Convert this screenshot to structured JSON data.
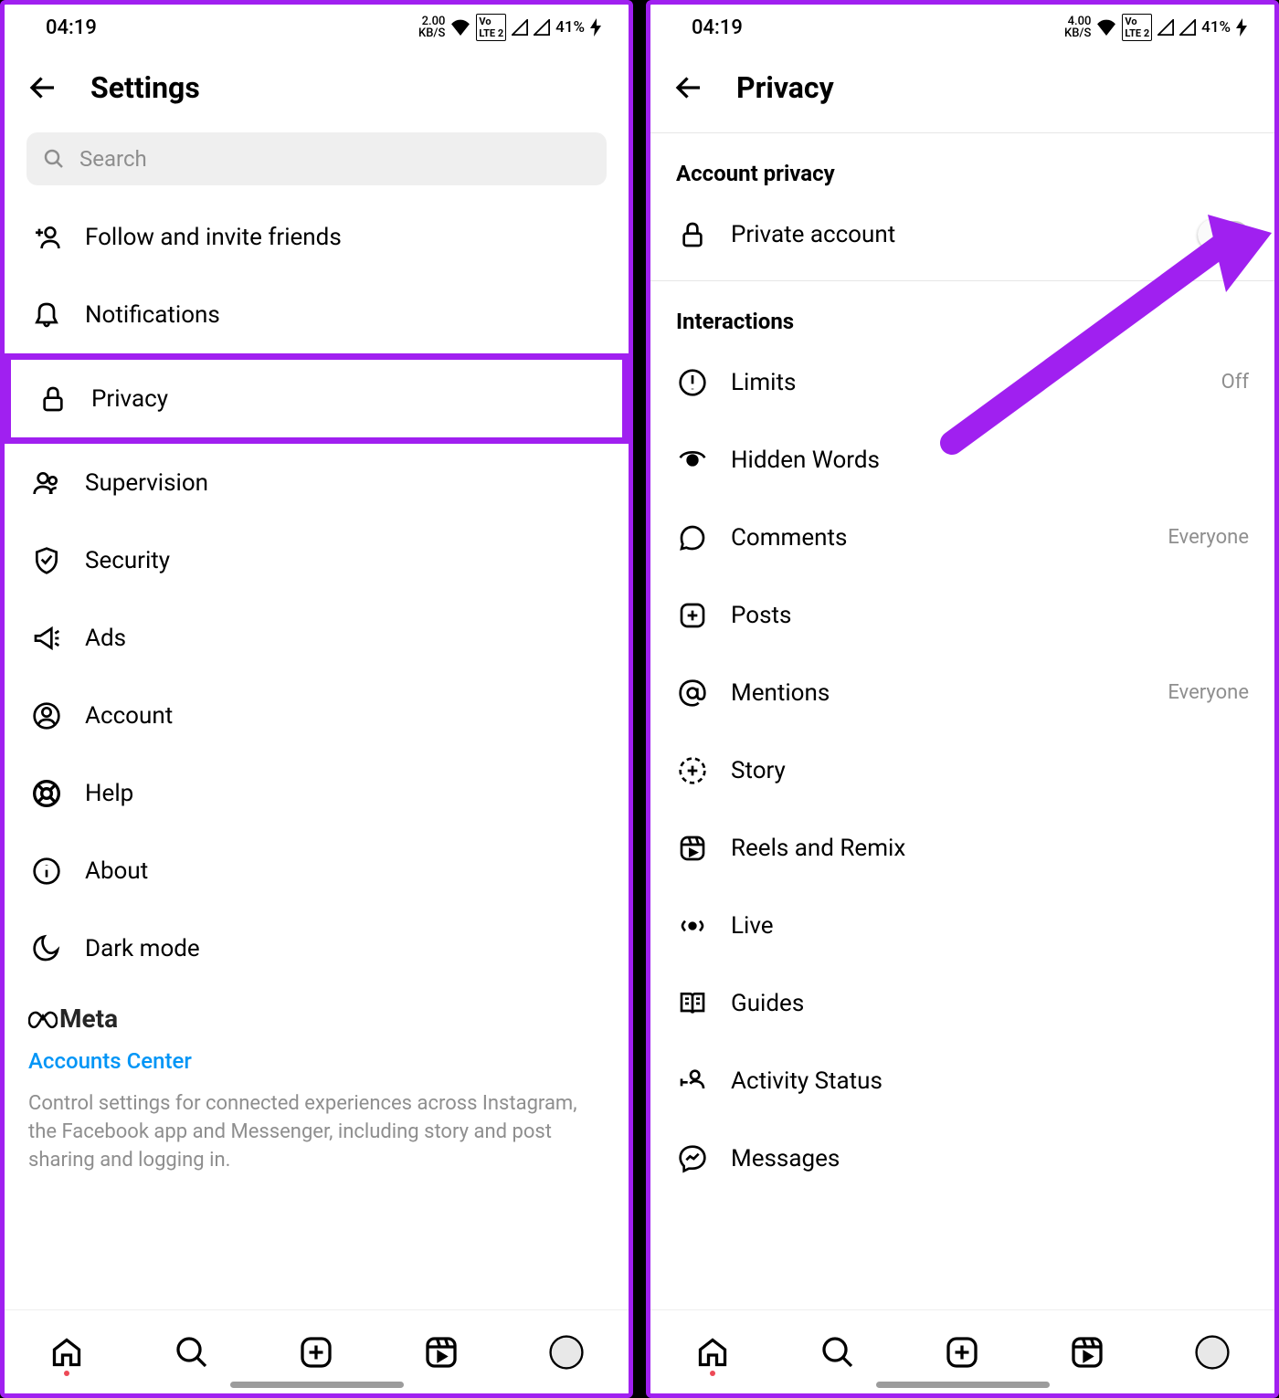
{
  "statusbar": {
    "time": "04:19",
    "speed_left": "2.00",
    "speed_right": "4.00",
    "speed_unit": "KB/S",
    "lte": "LTE 2",
    "volte": "Vo",
    "battery": "41%"
  },
  "left": {
    "title": "Settings",
    "search_placeholder": "Search",
    "items": [
      {
        "label": "Follow and invite friends",
        "icon": "add-person-icon"
      },
      {
        "label": "Notifications",
        "icon": "bell-icon"
      },
      {
        "label": "Privacy",
        "icon": "lock-icon",
        "highlighted": true
      },
      {
        "label": "Supervision",
        "icon": "people-icon"
      },
      {
        "label": "Security",
        "icon": "shield-icon"
      },
      {
        "label": "Ads",
        "icon": "megaphone-icon"
      },
      {
        "label": "Account",
        "icon": "user-circle-icon"
      },
      {
        "label": "Help",
        "icon": "lifebuoy-icon"
      },
      {
        "label": "About",
        "icon": "info-icon"
      },
      {
        "label": "Dark mode",
        "icon": "moon-icon"
      }
    ],
    "meta": {
      "logo": "Meta",
      "accounts_center": "Accounts Center",
      "description": "Control settings for connected experiences across Instagram, the Facebook app and Messenger, including story and post sharing and logging in."
    }
  },
  "right": {
    "title": "Privacy",
    "section1_title": "Account privacy",
    "private_account": {
      "label": "Private account",
      "state": "off"
    },
    "section2_title": "Interactions",
    "items": [
      {
        "label": "Limits",
        "trail": "Off",
        "icon": "alert-circle-icon"
      },
      {
        "label": "Hidden Words",
        "trail": "",
        "icon": "eye-hidden-icon"
      },
      {
        "label": "Comments",
        "trail": "Everyone",
        "icon": "comment-icon"
      },
      {
        "label": "Posts",
        "trail": "",
        "icon": "plus-square-icon"
      },
      {
        "label": "Mentions",
        "trail": "Everyone",
        "icon": "at-sign-icon"
      },
      {
        "label": "Story",
        "trail": "",
        "icon": "story-add-icon"
      },
      {
        "label": "Reels and Remix",
        "trail": "",
        "icon": "reels-icon"
      },
      {
        "label": "Live",
        "trail": "",
        "icon": "live-icon"
      },
      {
        "label": "Guides",
        "trail": "",
        "icon": "guides-icon"
      },
      {
        "label": "Activity Status",
        "trail": "",
        "icon": "activity-icon"
      },
      {
        "label": "Messages",
        "trail": "",
        "icon": "messenger-icon"
      }
    ]
  },
  "annotation": {
    "arrow_color": "#a020f0"
  }
}
